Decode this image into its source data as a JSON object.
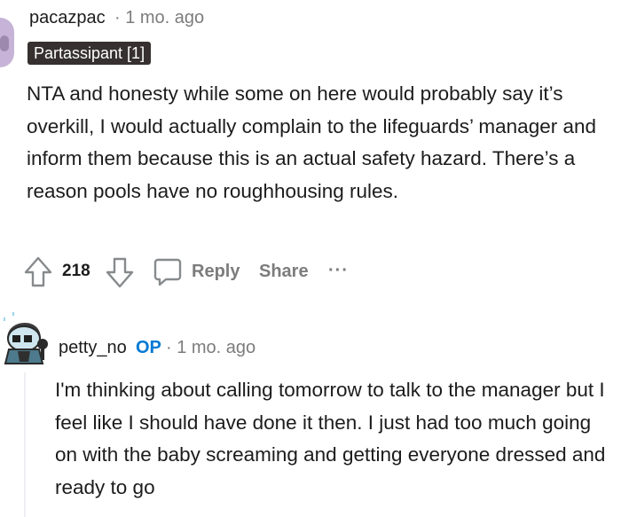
{
  "comment1": {
    "username": "pacazpac",
    "meta": "· 1 mo. ago",
    "flair": "Partassipant [1]",
    "body": "NTA and honesty while some on here would probably say it’s overkill, I would actually complain to the lifeguards’ manager and inform them because this is an actual safety hazard. There’s a reason pools have no roughhousing rules.",
    "score": "218",
    "reply_label": "Reply",
    "share_label": "Share",
    "more_label": "···"
  },
  "comment2": {
    "username": "petty_no",
    "op_badge": "OP",
    "meta": "· 1 mo. ago",
    "body": "I'm thinking about calling tomorrow to talk to the manager but I feel like I should have done it then. I just had too much going on with the baby screaming and getting everyone dressed and ready to go"
  },
  "colors": {
    "text": "#1c1c1c",
    "meta": "#7c7c7c",
    "op": "#0079d3",
    "flair_bg": "#363031"
  },
  "icons": [
    "upvote-icon",
    "downvote-icon",
    "comment-icon",
    "more-icon"
  ]
}
